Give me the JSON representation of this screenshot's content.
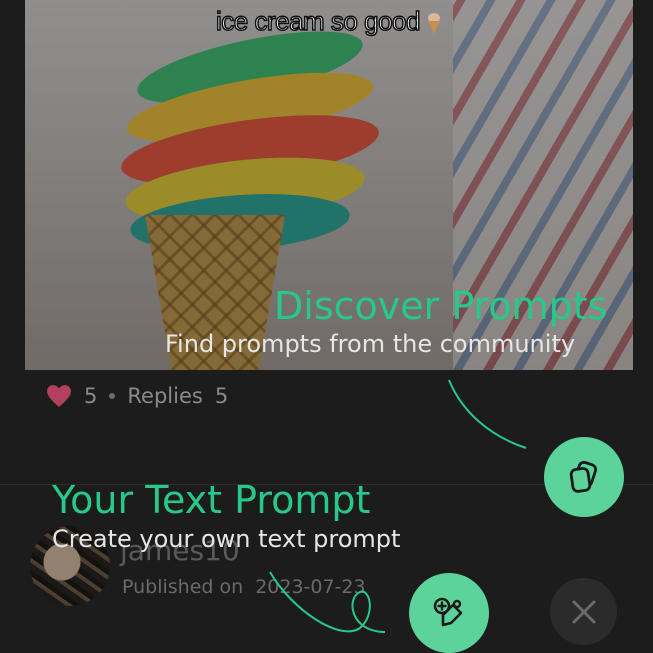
{
  "post": {
    "caption": "ice cream so good",
    "like_count": "5",
    "replies_label": "Replies",
    "replies_count": "5"
  },
  "author": {
    "name": "james10",
    "published_label": "Published on",
    "published_date": "2023-07-23"
  },
  "onboarding": {
    "discover": {
      "title": "Discover Prompts",
      "subtitle": "Find prompts from the community"
    },
    "create": {
      "title": "Your Text Prompt",
      "subtitle": "Create your own text prompt"
    }
  },
  "colors": {
    "accent": "#27c98a",
    "fab": "#5dd39c",
    "heart": "#b3405f",
    "background": "#1c1c1c"
  },
  "icons": {
    "discover_button": "stacked-cards-icon",
    "create_button": "create-prompt-icon",
    "close_button": "close-icon",
    "like": "heart-icon"
  }
}
